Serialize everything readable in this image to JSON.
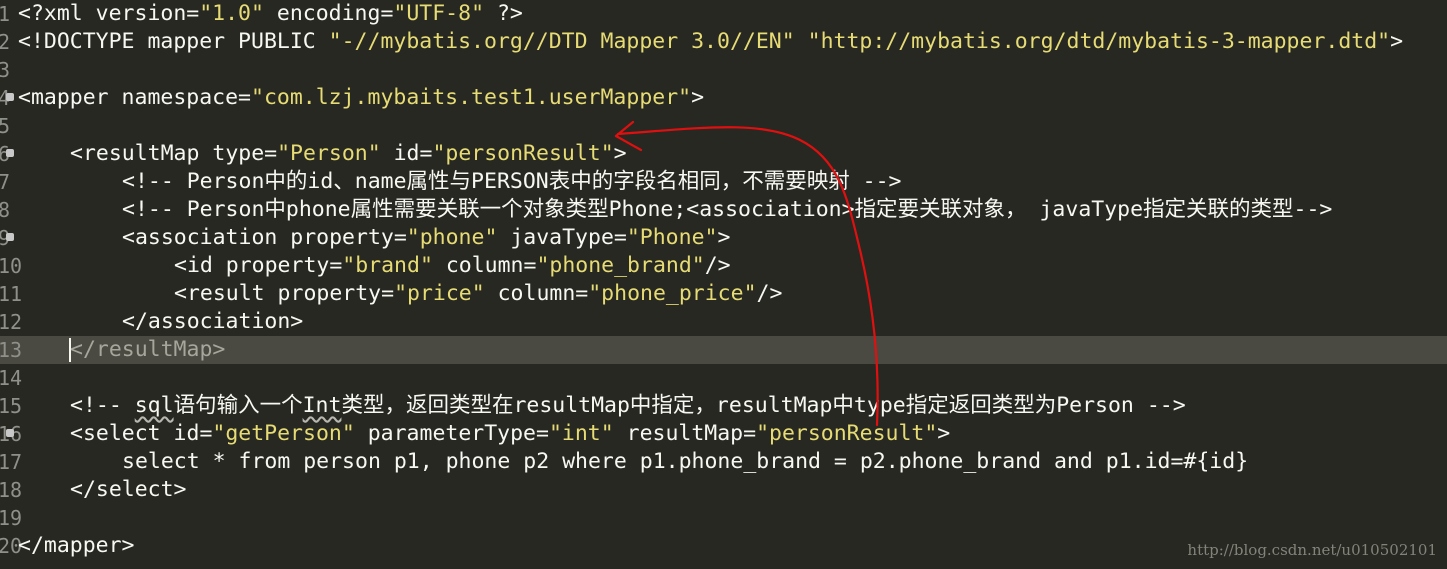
{
  "editor": {
    "lines": [
      {
        "num": "1",
        "text": "<?xml version=\"1.0\" encoding=\"UTF-8\" ?>"
      },
      {
        "num": "2",
        "text": "<!DOCTYPE mapper PUBLIC \"-//mybatis.org//DTD Mapper 3.0//EN\" \"http://mybatis.org/dtd/mybatis-3-mapper.dtd\">"
      },
      {
        "num": "3",
        "text": ""
      },
      {
        "num": "4",
        "text": "<mapper namespace=\"com.lzj.mybaits.test1.userMapper\">"
      },
      {
        "num": "5",
        "text": ""
      },
      {
        "num": "6",
        "text": "    <resultMap type=\"Person\" id=\"personResult\">"
      },
      {
        "num": "7",
        "text": "        <!-- Person中的id、name属性与PERSON表中的字段名相同，不需要映射 -->"
      },
      {
        "num": "8",
        "text": "        <!-- Person中phone属性需要关联一个对象类型Phone;<association>指定要关联对象， javaType指定关联的类型-->"
      },
      {
        "num": "9",
        "text": "        <association property=\"phone\" javaType=\"Phone\">"
      },
      {
        "num": "10",
        "text": "            <id property=\"brand\" column=\"phone_brand\"/>"
      },
      {
        "num": "11",
        "text": "            <result property=\"price\" column=\"phone_price\"/>"
      },
      {
        "num": "12",
        "text": "        </association>"
      },
      {
        "num": "13",
        "text": "    </resultMap>"
      },
      {
        "num": "14",
        "text": ""
      },
      {
        "num": "15",
        "text": "    <!-- sql语句输入一个Int类型，返回类型在resultMap中指定，resultMap中type指定返回类型为Person -->"
      },
      {
        "num": "16",
        "text": "    <select id=\"getPerson\" parameterType=\"int\" resultMap=\"personResult\">"
      },
      {
        "num": "17",
        "text": "        select * from person p1, phone p2 where p1.phone_brand = p2.phone_brand and p1.id=#{id}"
      },
      {
        "num": "18",
        "text": "    </select>"
      },
      {
        "num": "19",
        "text": ""
      },
      {
        "num": "20",
        "text": "</mapper>"
      }
    ]
  },
  "segments": {
    "l1": [
      "<?xml version=",
      "\"1.0\"",
      " encoding=",
      "\"UTF-8\"",
      " ?>"
    ],
    "l2": [
      "<!DOCTYPE mapper PUBLIC ",
      "\"-//mybatis.org//DTD Mapper 3.0//EN\"",
      " ",
      "\"http://mybatis.org/dtd/mybatis-3-mapper.dtd\"",
      ">"
    ],
    "l4": [
      "<mapper namespace=",
      "\"com.lzj.mybaits.test1.userMapper\"",
      ">"
    ],
    "l6": [
      "<resultMap type=",
      "\"Person\"",
      " id=",
      "\"personResult\"",
      ">"
    ],
    "l7": "<!-- Person中的id、name属性与PERSON表中的字段名相同，不需要映射 -->",
    "l8": "<!-- Person中phone属性需要关联一个对象类型Phone;<association>指定要关联对象， javaType指定关联的类型-->",
    "l9": [
      "<association property=",
      "\"phone\"",
      " javaType=",
      "\"Phone\"",
      ">"
    ],
    "l10": [
      "<id property=",
      "\"brand\"",
      " column=",
      "\"phone_brand\"",
      "/>"
    ],
    "l11": [
      "<result property=",
      "\"price\"",
      " column=",
      "\"phone_price\"",
      "/>"
    ],
    "l12": "</association>",
    "l13a": "<",
    "l13b": "/resultMap>",
    "l15a": "<!-- ",
    "l15b": "sql",
    "l15c": "语句输入一个",
    "l15d": "Int",
    "l15e": "类型，返回类型在resultMap中指定，resultMap中type指定返回类型为Person -->",
    "l16": [
      "<select id=",
      "\"getPerson\"",
      " parameterType=",
      "\"int\"",
      " resultMap=",
      "\"personResult\"",
      ">"
    ],
    "l17": "select * from person p1, phone p2 where p1.phone_brand = p2.phone_brand and p1.id=#{id}",
    "l18": "</select>",
    "l20": "</mapper>"
  },
  "watermark": "http://blog.csdn.net/u010502101",
  "colors": {
    "background": "#272822",
    "current_line": "#4a4a42",
    "string": "#e6db74",
    "text": "#f8f8f2",
    "annotation_arrow": "#e01010"
  }
}
